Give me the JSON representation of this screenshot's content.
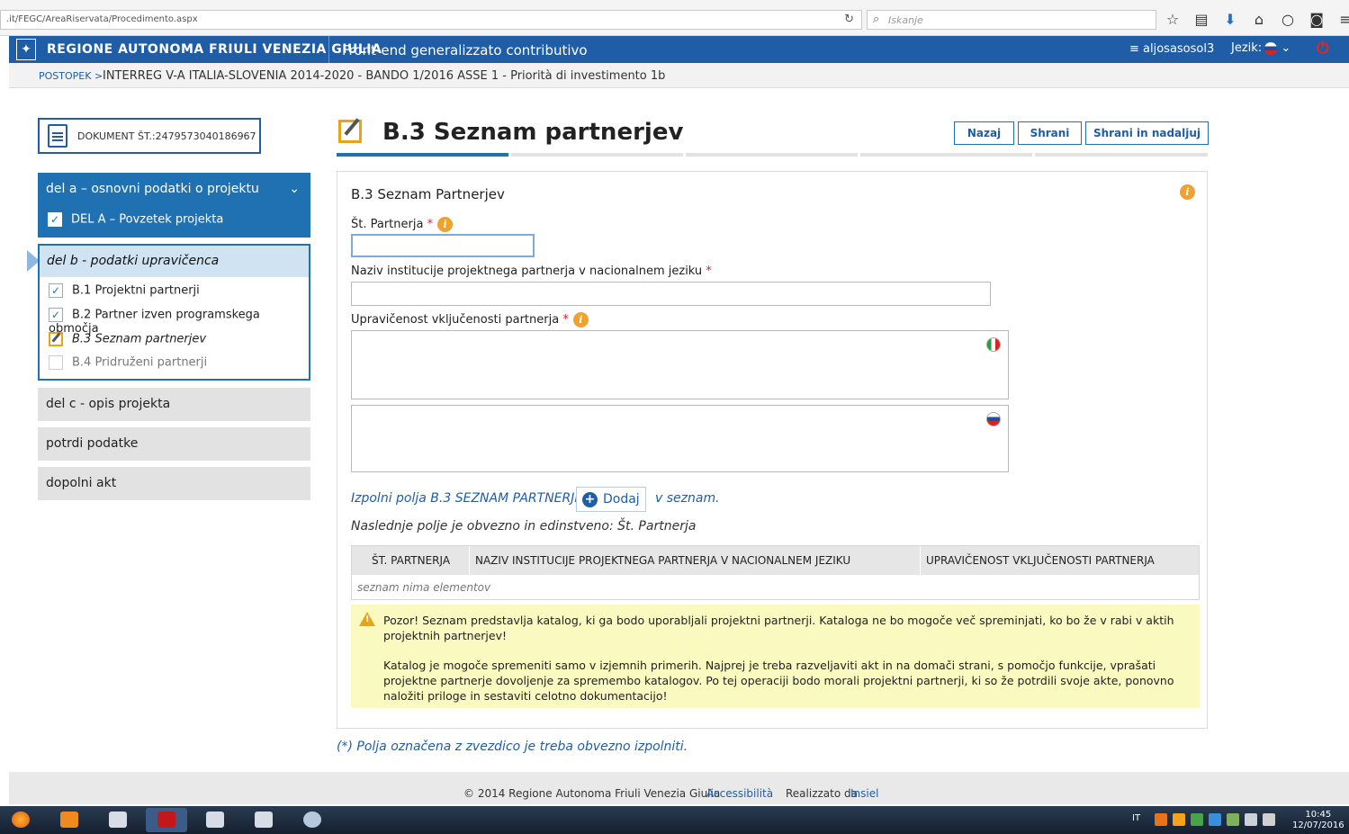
{
  "browser": {
    "url": ".it/FEGC/AreaRiservata/Procedimento.aspx",
    "search_placeholder": "Iskanje",
    "icons": [
      "star-icon",
      "reader-icon",
      "download-icon",
      "home-icon",
      "chat-icon",
      "pocket-icon",
      "menu-icon"
    ]
  },
  "header": {
    "region": "Regione Autonoma Friuli Venezia Giulia",
    "app_title": "Front-end generalizzato contributivo",
    "user": "≡ aljosasosol3",
    "language_label": "Jezik:",
    "colors": {
      "bar": "#1f5ea6",
      "accent": "#1f71b2",
      "warning": "#f0a12e"
    }
  },
  "breadcrumb": {
    "key": "POSTOPEK >",
    "value": "INTERREG V-A ITALIA-SLOVENIA 2014-2020 - BANDO 1/2016 ASSE 1 - Priorità di investimento 1b"
  },
  "sidebar": {
    "document": "DOKUMENT ŠT.:2479573040186967",
    "section_a": {
      "title": "del a – osnovni podatki o projektu",
      "items": [
        {
          "label": "DEL A – Povzetek projekta",
          "status": "checked"
        }
      ]
    },
    "section_b": {
      "title": "del b - podatki upravičenca",
      "items": [
        {
          "label": "B.1 Projektni partnerji",
          "status": "checked"
        },
        {
          "label": "B.2 Partner izven programskega območja",
          "status": "checked"
        },
        {
          "label": "B.3 Seznam partnerjev",
          "status": "editing"
        },
        {
          "label": "B.4 Pridruženi partnerji",
          "status": "empty"
        }
      ]
    },
    "buttons": [
      "del c - opis projekta",
      "potrdi podatke",
      "dopolni akt"
    ]
  },
  "page": {
    "title": "B.3 Seznam partnerjev",
    "actions": {
      "back": "Nazaj",
      "save": "Shrani",
      "save_continue": "Shrani in nadaljuj"
    }
  },
  "form": {
    "panel_title": "B.3 Seznam Partnerjev",
    "partner_no": {
      "label": "Št. Partnerja",
      "value": ""
    },
    "institution_name": {
      "label": "Naziv institucije projektnega partnerja v nacionalnem jeziku",
      "value": ""
    },
    "eligibility": {
      "label": "Upravičenost vključenosti partnerja",
      "value_it": "",
      "value_si": ""
    },
    "fill_prefix": "Izpolni polja B.3 SEZNAM PARTNERJEV v",
    "add_button": "Dodaj",
    "fill_suffix": "v seznam.",
    "unique_note": "Naslednje polje je obvezno in edinstveno: Št. Partnerja"
  },
  "table": {
    "columns": [
      "ŠT. PARTNERJA",
      "NAZIV INSTITUCIJE PROJEKTNEGA PARTNERJA V NACIONALNEM JEZIKU",
      "UPRAVIČENOST VKLJUČENOSTI PARTNERJA"
    ],
    "rows": [],
    "empty_text": "seznam nima elementov"
  },
  "warning": {
    "p1": "Pozor! Seznam predstavlja katalog, ki ga bodo uporabljali projektni partnerji. Kataloga ne bo mogoče več spreminjati, ko bo že v rabi v aktih projektnih partnerjev!",
    "p2": "Katalog je mogoče spremeniti samo v izjemnih primerih. Najprej je treba razveljaviti akt in na domači strani, s pomočjo funkcije, vprašati projektne partnerje dovoljenje za spremembo katalogov. Po tej operaciji bodo morali projektni partnerji, ki so že potrdili svoje akte, ponovno naložiti priloge in sestaviti celotno dokumentacijo!"
  },
  "required_note": "(*) Polja označena z zvezdico je treba obvezno izpolniti.",
  "footer": {
    "copyright": "© 2014 Regione Autonoma Friuli Venezia Giulia",
    "accessibility": "Accessibilità",
    "realized_by": "Realizzato da",
    "company": "Insiel"
  },
  "taskbar": {
    "language": "IT",
    "time": "10:45",
    "date": "12/07/2016"
  }
}
